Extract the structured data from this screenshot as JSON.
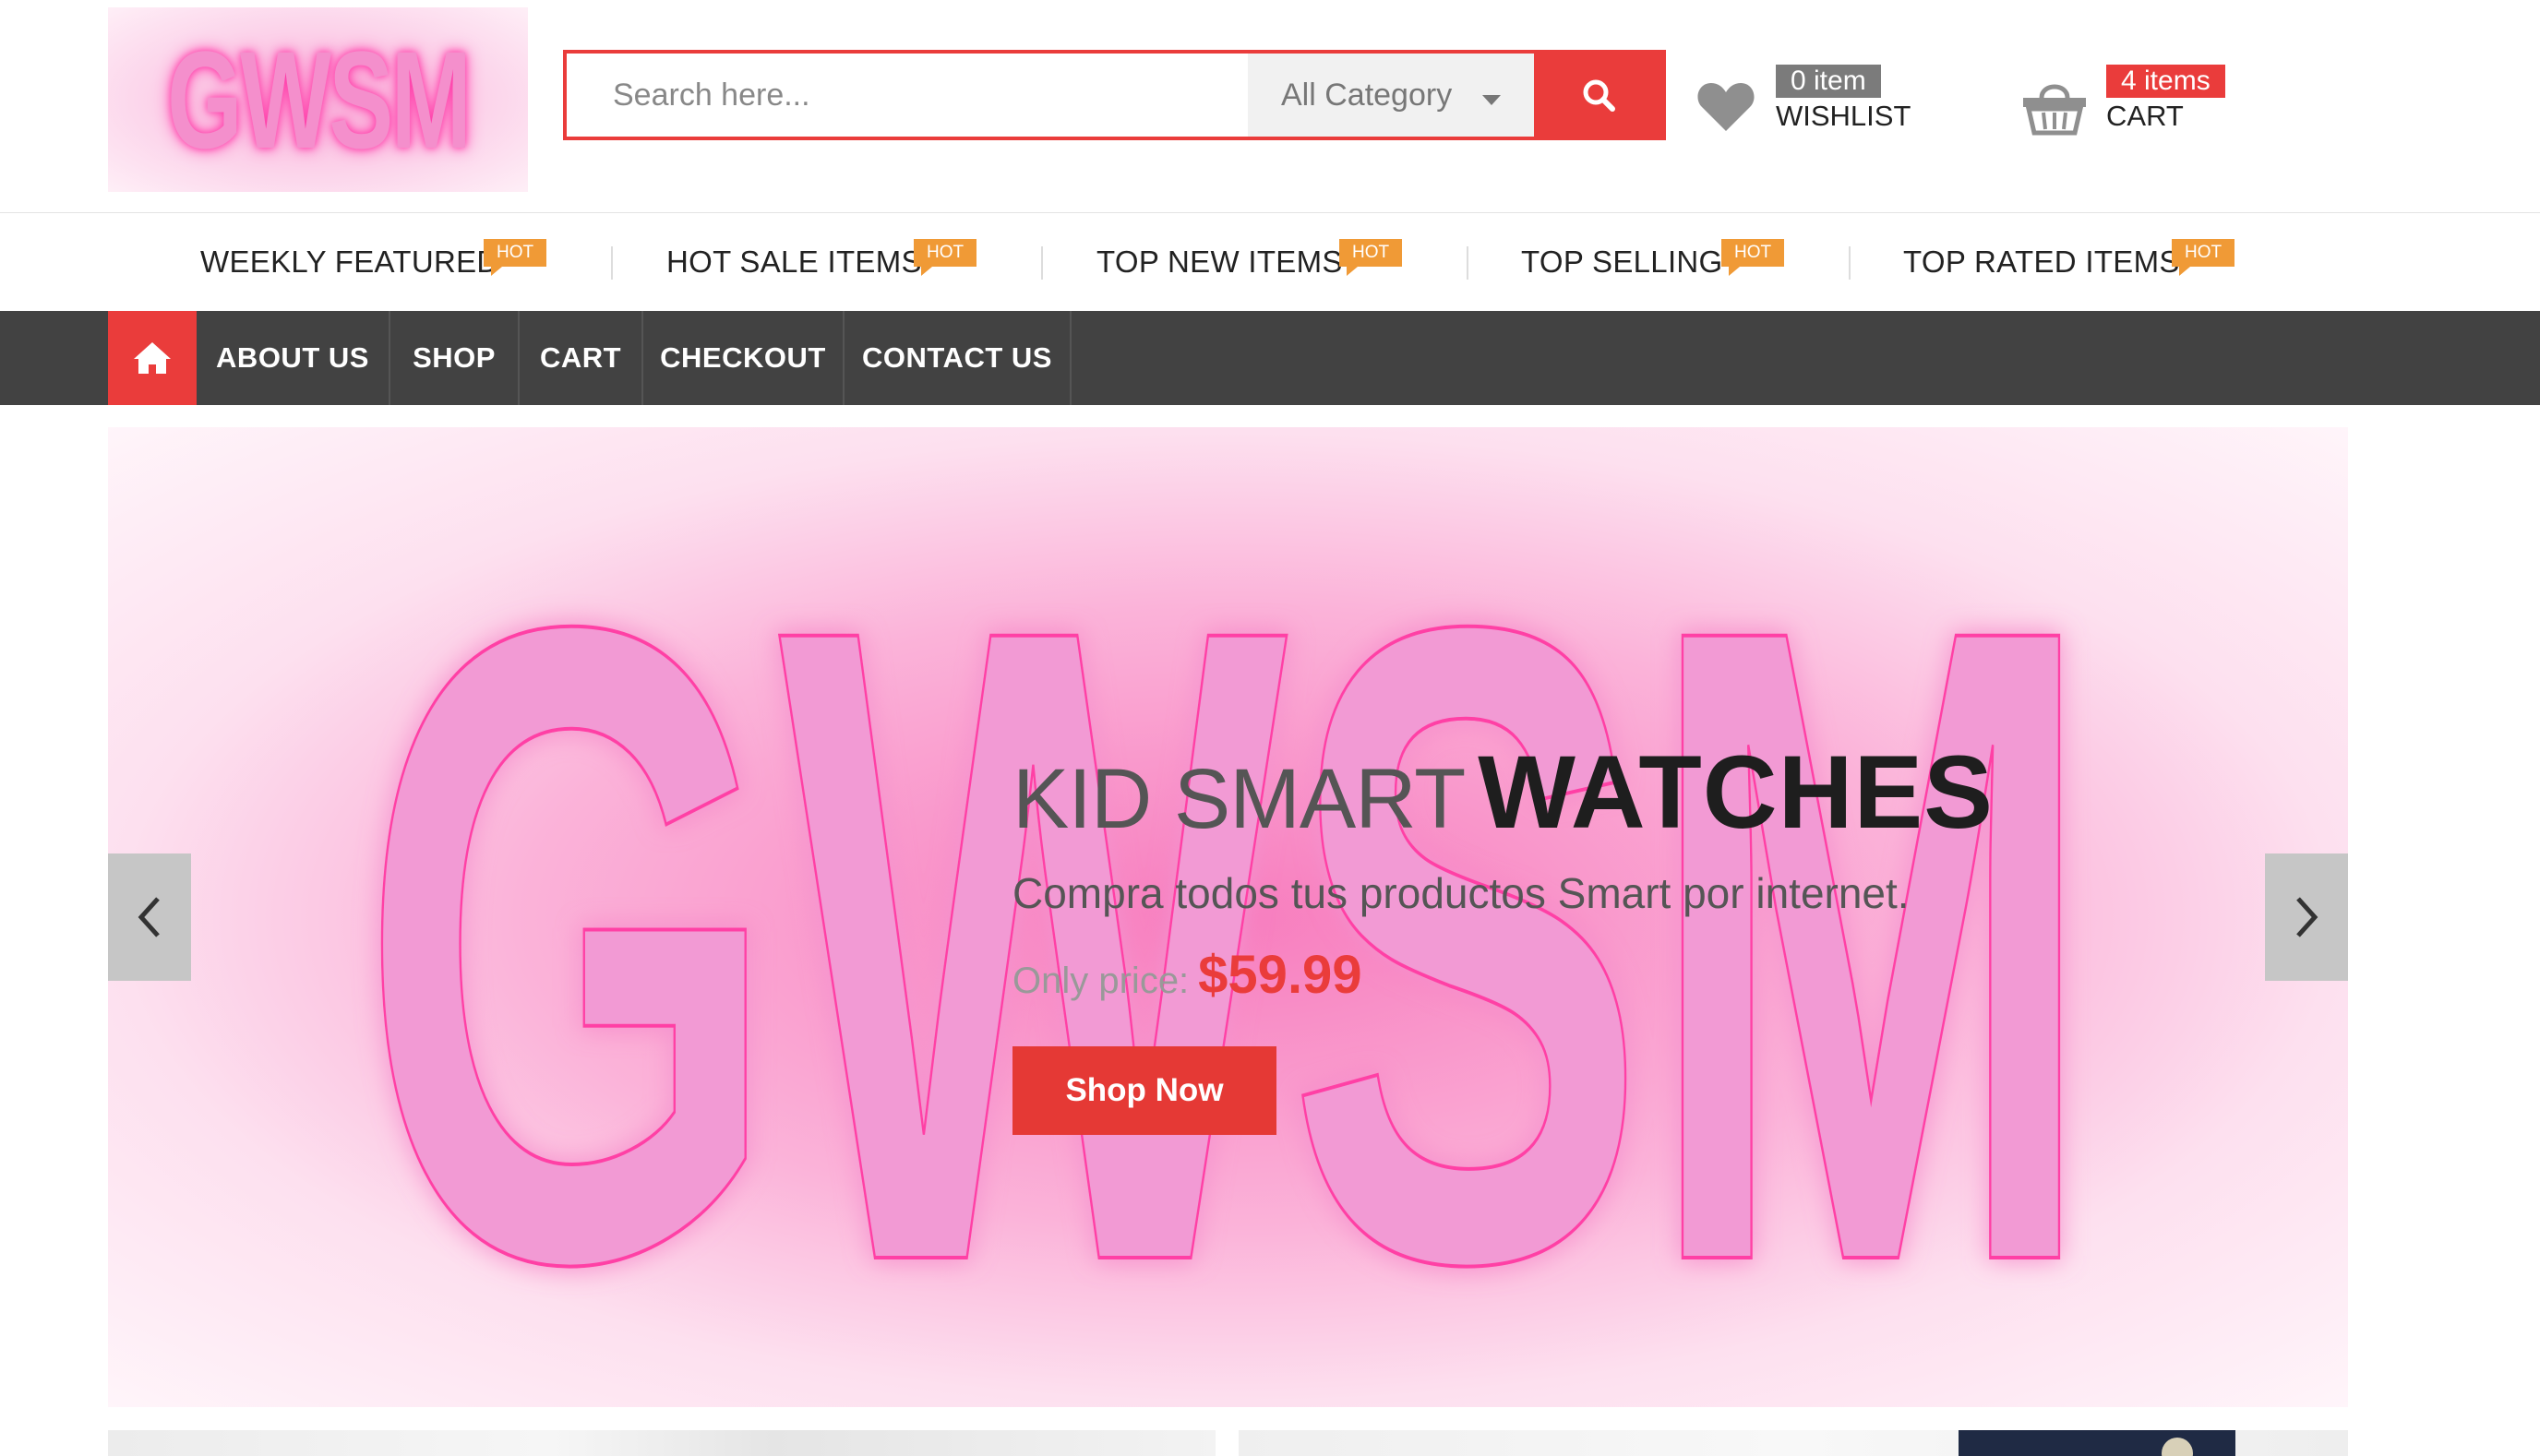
{
  "brand": {
    "logo_text": "GWSM"
  },
  "search": {
    "placeholder": "Search here...",
    "category": "All Category"
  },
  "wishlist": {
    "count": "0 item",
    "label": "WISHLIST"
  },
  "cart": {
    "count": "4 items",
    "label": "CART"
  },
  "hot_links": [
    {
      "label": "WEEKLY FEATURED",
      "tag": "HOT"
    },
    {
      "label": "HOT SALE ITEMS",
      "tag": "HOT"
    },
    {
      "label": "TOP NEW ITEMS",
      "tag": "HOT"
    },
    {
      "label": "TOP SELLING",
      "tag": "HOT"
    },
    {
      "label": "TOP RATED ITEMS",
      "tag": "HOT"
    }
  ],
  "nav": {
    "home_icon": "home-icon",
    "items": [
      "ABOUT US",
      "SHOP",
      "CART",
      "CHECKOUT",
      "CONTACT US"
    ]
  },
  "hero": {
    "watermark": "GWSM",
    "title_light": "KID SMART",
    "title_bold": "WATCHES",
    "subtitle": "Compra todos tus productos Smart por internet.",
    "price_label": "Only price:",
    "price": "$59.99",
    "cta": "Shop Now"
  },
  "colors": {
    "accent": "#ea3c3b",
    "nav_bg": "#424242",
    "hot_tag": "#f09a36",
    "logo_pink": "#f48fcc"
  },
  "icons": [
    "search-icon",
    "heart-icon",
    "basket-icon",
    "home-icon",
    "chevron-left-icon",
    "chevron-right-icon",
    "caret-down-icon"
  ]
}
